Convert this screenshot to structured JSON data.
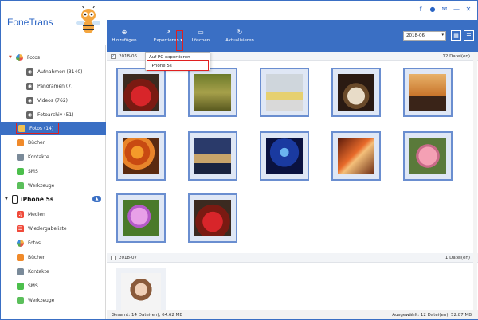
{
  "app": {
    "title": "FoneTrans"
  },
  "window_controls": [
    "f",
    "speech",
    "mail",
    "minimize",
    "close"
  ],
  "sidebar": {
    "library": [
      {
        "label": "Fotos",
        "icon": "photos-icon",
        "arrow": "expanded"
      },
      {
        "label": "Aufnahmen (3140)",
        "icon": "camera-icon"
      },
      {
        "label": "Panoramen (7)",
        "icon": "camera-icon"
      },
      {
        "label": "Videos (762)",
        "icon": "camera-icon"
      },
      {
        "label": "Fotoarchiv (51)",
        "icon": "camera-icon"
      },
      {
        "label": "Fotos (14)",
        "icon": "folder-icon",
        "selected": true
      },
      {
        "label": "Bücher",
        "icon": "book-icon"
      },
      {
        "label": "Kontakte",
        "icon": "contacts-icon"
      },
      {
        "label": "SMS",
        "icon": "sms-icon"
      },
      {
        "label": "Werkzeuge",
        "icon": "toolbox-icon"
      }
    ],
    "device": {
      "name": "iPhone 5s",
      "items": [
        {
          "label": "Medien",
          "icon": "media-icon"
        },
        {
          "label": "Wiedergabeliste",
          "icon": "playlist-icon"
        },
        {
          "label": "Fotos",
          "icon": "photos-icon"
        },
        {
          "label": "Bücher",
          "icon": "book-icon"
        },
        {
          "label": "Kontakte",
          "icon": "contacts-icon"
        },
        {
          "label": "SMS",
          "icon": "sms-icon"
        },
        {
          "label": "Werkzeuge",
          "icon": "toolbox-icon"
        }
      ]
    }
  },
  "toolbar": {
    "add_label": "Hinzufügen",
    "export_label": "Exportieren",
    "delete_label": "Löschen",
    "refresh_label": "Aktualisieren",
    "date_value": "2018-06"
  },
  "export_menu": {
    "items": [
      "Auf PC exportieren",
      "iPhone 5s"
    ]
  },
  "groups": [
    {
      "date": "2018-06",
      "count": "12 Datei(en)",
      "checked": true
    },
    {
      "date": "2018-07",
      "count": "1 Datei(en)",
      "checked": false
    }
  ],
  "status": {
    "left": "Gesamt: 14 Datei(en), 64.62 MB",
    "right": "Ausgewählt: 12 Datei(en), 52.87 MB"
  },
  "colors": {
    "accent": "#3a6fc4",
    "highlight_box": "#e02020"
  }
}
